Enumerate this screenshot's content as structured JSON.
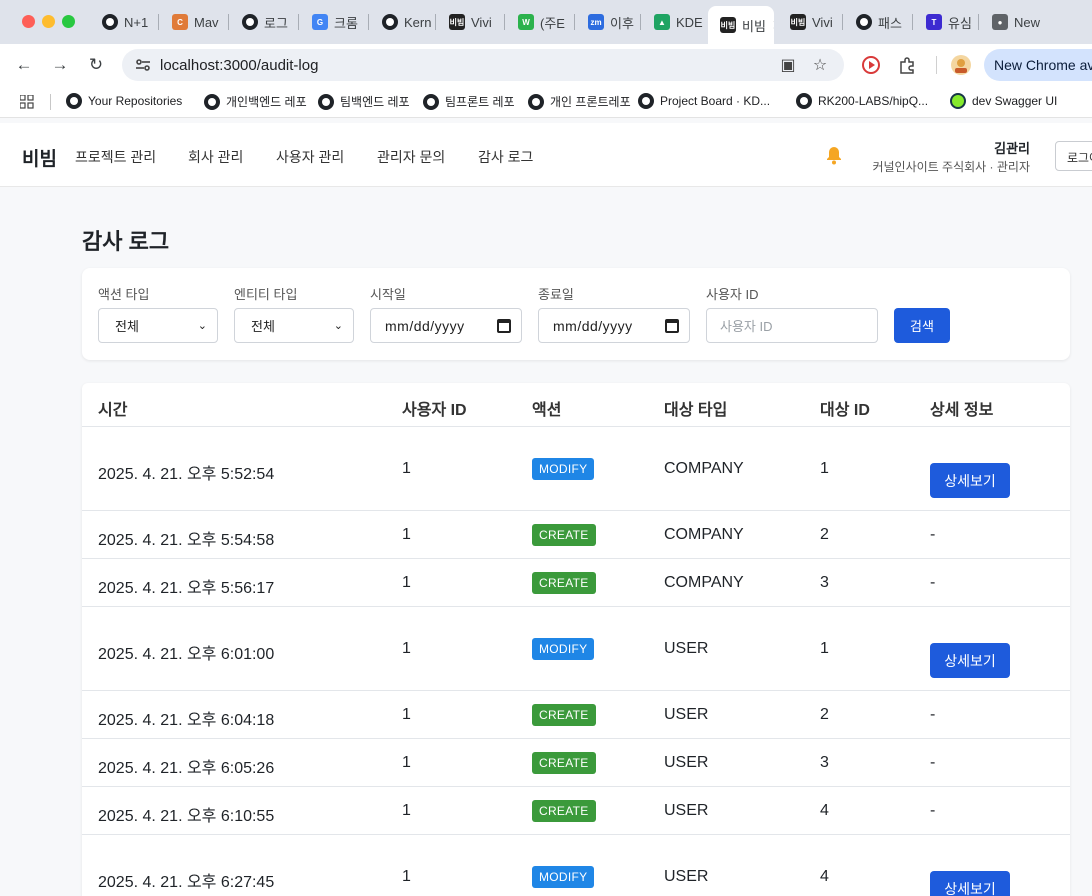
{
  "browser": {
    "tabs": [
      {
        "label": "N+1",
        "favicon": "github-icon",
        "color": "#1f2328"
      },
      {
        "label": "Mav",
        "favicon": "c-icon",
        "color": "#e07b39"
      },
      {
        "label": "로그",
        "favicon": "github-icon",
        "color": "#1f2328"
      },
      {
        "label": "크롬",
        "favicon": "google-icon",
        "color": "#4285f4"
      },
      {
        "label": "Kern",
        "favicon": "github-icon",
        "color": "#1f2328"
      },
      {
        "label": "Vivi",
        "favicon": "vivi-icon",
        "color": "#222222"
      },
      {
        "label": "(주E",
        "favicon": "w-icon",
        "color": "#2bb24c"
      },
      {
        "label": "이후",
        "favicon": "zm-icon",
        "color": "#2d6cdf"
      },
      {
        "label": "KDE",
        "favicon": "drive-icon",
        "color": "#1fa463"
      },
      {
        "label": "비빔",
        "favicon": "vivi-icon",
        "color": "#222222"
      },
      {
        "label": "Vivi",
        "favicon": "vivi-icon",
        "color": "#222222"
      },
      {
        "label": "패스",
        "favicon": "github-icon",
        "color": "#1f2328"
      },
      {
        "label": "유심",
        "favicon": "t-icon",
        "color": "#3d2bd1"
      },
      {
        "label": "New",
        "favicon": "chrome-icon",
        "color": "#5f6368"
      }
    ],
    "active_tab_index": 9,
    "url": "localhost:3000/audit-log",
    "chrome_pill": "New Chrome ava",
    "bookmarks": [
      {
        "label": "Your Repositories",
        "icon": "github-icon"
      },
      {
        "label": "개인백엔드 레포",
        "icon": "github-icon"
      },
      {
        "label": "팀백엔드 레포",
        "icon": "github-icon"
      },
      {
        "label": "팀프론트 레포",
        "icon": "github-icon"
      },
      {
        "label": "개인 프론트레포",
        "icon": "github-icon"
      },
      {
        "label": "Project Board · KD...",
        "icon": "github-icon"
      },
      {
        "label": "RK200-LABS/hipQ...",
        "icon": "github-icon"
      },
      {
        "label": "dev Swagger UI",
        "icon": "swagger-icon"
      }
    ]
  },
  "app": {
    "brand": "비빔",
    "nav": [
      "프로젝트 관리",
      "회사 관리",
      "사용자 관리",
      "관리자 문의",
      "감사 로그"
    ],
    "user_name": "김관리",
    "user_org": "커널인사이트 주식회사 · 관리자",
    "logout_label": "로그아웃",
    "accent": "#1e5bdc"
  },
  "page": {
    "title": "감사 로그",
    "filters": {
      "action_type_label": "액션 타입",
      "action_type_value": "전체",
      "entity_type_label": "엔티티 타입",
      "entity_type_value": "전체",
      "start_date_label": "시작일",
      "start_date_value": "mm/dd/yyyy",
      "end_date_label": "종료일",
      "end_date_value": "mm/dd/yyyy",
      "user_id_label": "사용자 ID",
      "user_id_placeholder": "사용자 ID",
      "search_label": "검색"
    },
    "table": {
      "headers": [
        "시간",
        "사용자 ID",
        "액션",
        "대상 타입",
        "대상 ID",
        "상세 정보"
      ],
      "detail_button_label": "상세보기",
      "rows": [
        {
          "time": "2025. 4. 21. 오후 5:52:54",
          "user_id": "1",
          "action": "MODIFY",
          "target_type": "COMPANY",
          "target_id": "1",
          "detail": "상세보기"
        },
        {
          "time": "2025. 4. 21. 오후 5:54:58",
          "user_id": "1",
          "action": "CREATE",
          "target_type": "COMPANY",
          "target_id": "2",
          "detail": "-"
        },
        {
          "time": "2025. 4. 21. 오후 5:56:17",
          "user_id": "1",
          "action": "CREATE",
          "target_type": "COMPANY",
          "target_id": "3",
          "detail": "-"
        },
        {
          "time": "2025. 4. 21. 오후 6:01:00",
          "user_id": "1",
          "action": "MODIFY",
          "target_type": "USER",
          "target_id": "1",
          "detail": "상세보기"
        },
        {
          "time": "2025. 4. 21. 오후 6:04:18",
          "user_id": "1",
          "action": "CREATE",
          "target_type": "USER",
          "target_id": "2",
          "detail": "-"
        },
        {
          "time": "2025. 4. 21. 오후 6:05:26",
          "user_id": "1",
          "action": "CREATE",
          "target_type": "USER",
          "target_id": "3",
          "detail": "-"
        },
        {
          "time": "2025. 4. 21. 오후 6:10:55",
          "user_id": "1",
          "action": "CREATE",
          "target_type": "USER",
          "target_id": "4",
          "detail": "-"
        },
        {
          "time": "2025. 4. 21. 오후 6:27:45",
          "user_id": "1",
          "action": "MODIFY",
          "target_type": "USER",
          "target_id": "4",
          "detail": "상세보기"
        }
      ]
    }
  }
}
